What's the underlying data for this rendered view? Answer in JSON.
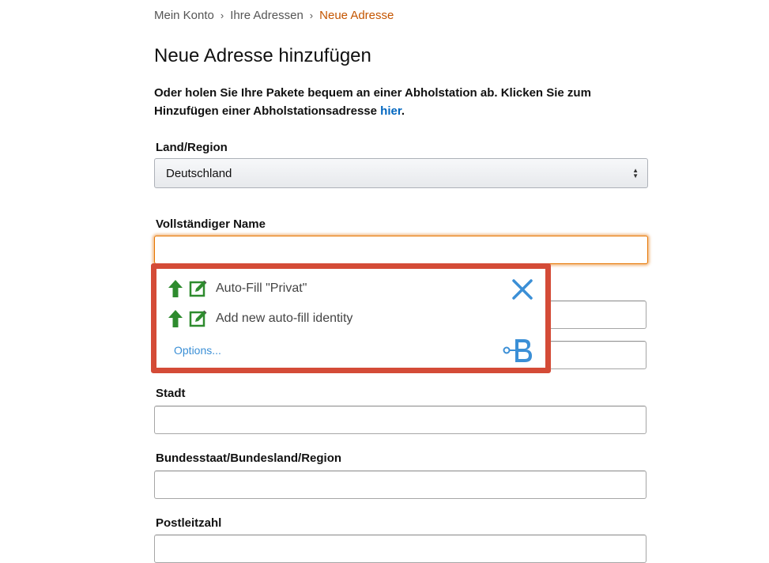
{
  "breadcrumb": {
    "items": [
      "Mein Konto",
      "Ihre Adressen"
    ],
    "current": "Neue Adresse",
    "separator": "›"
  },
  "page": {
    "title": "Neue Adresse hinzufügen",
    "intro_text": "Oder holen Sie Ihre Pakete bequem an einer Abholstation ab. Klicken Sie zum Hinzufügen einer Abholstationsadresse ",
    "intro_link": "hier",
    "intro_end": "."
  },
  "form": {
    "country_label": "Land/Region",
    "country_value": "Deutschland",
    "name_label": "Vollständiger Name",
    "name_value": "",
    "city_label": "Stadt",
    "city_value": "",
    "state_label": "Bundesstaat/Bundesland/Region",
    "state_value": "",
    "zip_label": "Postleitzahl"
  },
  "autofill_popup": {
    "items": [
      {
        "label": "Auto-Fill \"Privat\""
      },
      {
        "label": "Add new auto-fill identity"
      }
    ],
    "options_label": "Options...",
    "border_color": "#d44b37",
    "icons": [
      "up-arrow-icon",
      "edit-icon",
      "close-icon",
      "roboform-logo-icon"
    ]
  },
  "colors": {
    "link": "#0066c0",
    "breadcrumb_current": "#c45500",
    "focus": "#e77600",
    "icon_green": "#2e8b2e",
    "icon_blue": "#3b8fd6"
  }
}
